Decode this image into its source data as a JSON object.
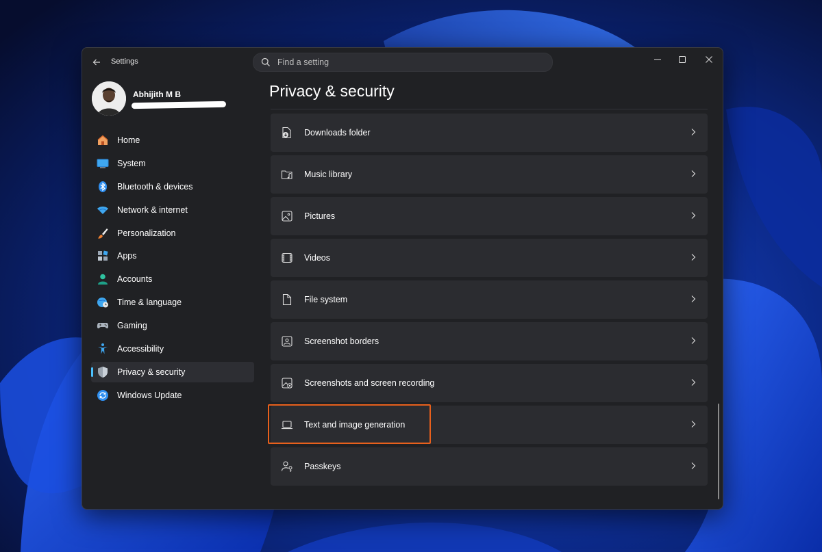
{
  "window": {
    "app_title": "Settings",
    "search_placeholder": "Find a setting",
    "page_title": "Privacy & security"
  },
  "profile": {
    "name": "Abhijith M B"
  },
  "sidebar": {
    "items": [
      {
        "label": "Home",
        "icon": "home-icon"
      },
      {
        "label": "System",
        "icon": "monitor-icon"
      },
      {
        "label": "Bluetooth & devices",
        "icon": "bluetooth-icon"
      },
      {
        "label": "Network & internet",
        "icon": "wifi-icon"
      },
      {
        "label": "Personalization",
        "icon": "brush-icon"
      },
      {
        "label": "Apps",
        "icon": "apps-icon"
      },
      {
        "label": "Accounts",
        "icon": "person-icon"
      },
      {
        "label": "Time & language",
        "icon": "globe-clock-icon"
      },
      {
        "label": "Gaming",
        "icon": "gamepad-icon"
      },
      {
        "label": "Accessibility",
        "icon": "accessibility-icon"
      },
      {
        "label": "Privacy & security",
        "icon": "shield-icon",
        "selected": true
      },
      {
        "label": "Windows Update",
        "icon": "update-icon"
      }
    ]
  },
  "settings": {
    "items": [
      {
        "label": "Downloads folder",
        "icon": "download-folder-icon"
      },
      {
        "label": "Music library",
        "icon": "music-folder-icon"
      },
      {
        "label": "Pictures",
        "icon": "picture-icon"
      },
      {
        "label": "Videos",
        "icon": "video-icon"
      },
      {
        "label": "File system",
        "icon": "file-icon"
      },
      {
        "label": "Screenshot borders",
        "icon": "screenshot-border-icon"
      },
      {
        "label": "Screenshots and screen recording",
        "icon": "screen-recording-icon"
      },
      {
        "label": "Text and image generation",
        "icon": "laptop-icon",
        "highlighted": true
      },
      {
        "label": "Passkeys",
        "icon": "passkey-icon"
      }
    ]
  },
  "colors": {
    "accent": "#4cc2ff",
    "highlight_border": "#e8601c",
    "window_bg": "#202124",
    "row_bg": "#2b2c30"
  }
}
